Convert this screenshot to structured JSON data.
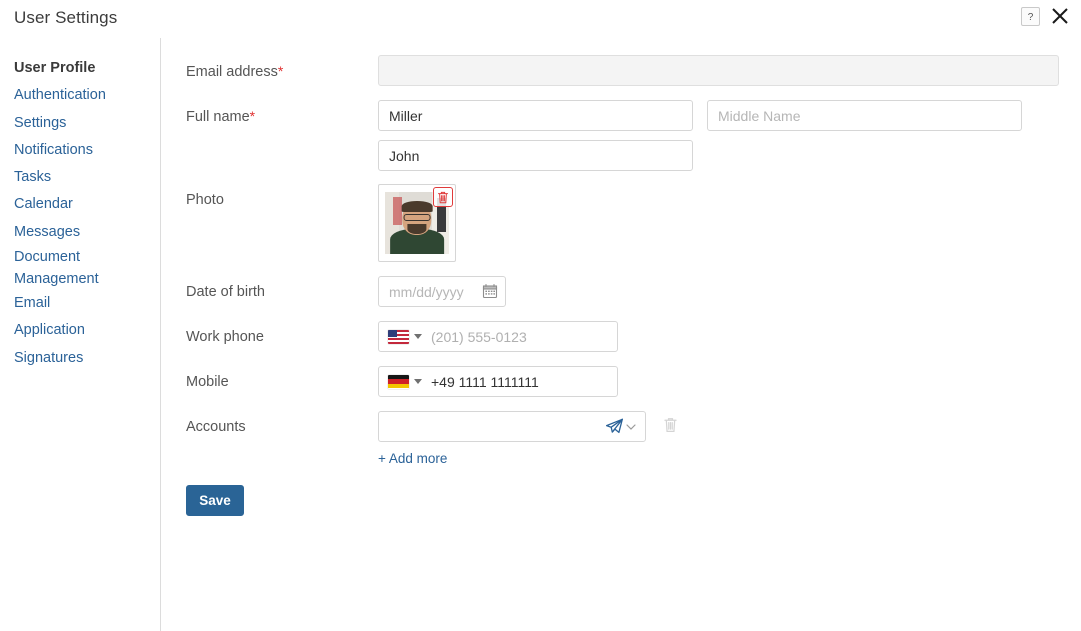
{
  "header": {
    "title": "User Settings",
    "help_icon": "question-mark-icon",
    "close_icon": "close-icon"
  },
  "sidebar": {
    "items": [
      {
        "label": "User Profile",
        "active": true
      },
      {
        "label": "Authentication",
        "active": false
      },
      {
        "label": "Settings",
        "active": false
      },
      {
        "label": "Notifications",
        "active": false
      },
      {
        "label": "Tasks",
        "active": false
      },
      {
        "label": "Calendar",
        "active": false
      },
      {
        "label": "Messages",
        "active": false
      },
      {
        "label": "Document Management",
        "active": false
      },
      {
        "label": "Email",
        "active": false
      },
      {
        "label": "Application",
        "active": false
      },
      {
        "label": "Signatures",
        "active": false
      }
    ]
  },
  "form": {
    "email": {
      "label": "Email address",
      "required_marker": "*",
      "value": "",
      "placeholder": "",
      "disabled": true
    },
    "full_name": {
      "label": "Full name",
      "required_marker": "*",
      "last_name_value": "Miller",
      "middle_name_value": "",
      "middle_name_placeholder": "Middle Name",
      "first_name_value": "John"
    },
    "photo": {
      "label": "Photo",
      "delete_icon": "trash-icon",
      "delete_icon_color": "#e03b3b"
    },
    "date_of_birth": {
      "label": "Date of birth",
      "value": "",
      "placeholder": "mm/dd/yyyy",
      "calendar_icon": "calendar-icon"
    },
    "work_phone": {
      "label": "Work phone",
      "country_flag": "flag-us-icon",
      "value": "",
      "placeholder": "(201) 555-0123"
    },
    "mobile": {
      "label": "Mobile",
      "country_flag": "flag-de-icon",
      "value": "+49 1111 1111111",
      "placeholder": ""
    },
    "accounts": {
      "label": "Accounts",
      "value": "",
      "placeholder": "",
      "type_icon": "telegram-icon",
      "type_icon_color": "#2b6298",
      "chevron_icon": "chevron-down-icon",
      "delete_icon": "trash-icon",
      "add_more_label": "+ Add more"
    },
    "save_label": "Save",
    "save_color": "#2a6496"
  }
}
